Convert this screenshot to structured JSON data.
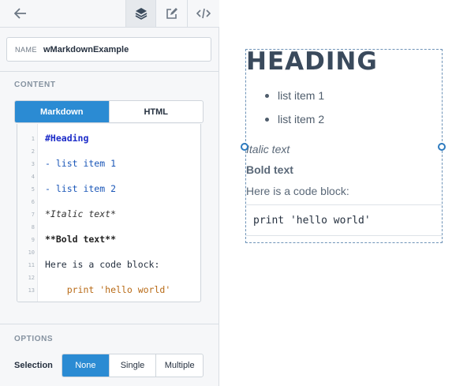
{
  "toolbar": {
    "back_icon": "arrow-left-icon",
    "tabs": [
      "layers-icon",
      "edit-icon",
      "code-icon"
    ]
  },
  "name_field": {
    "label": "NAME",
    "value": "wMarkdownExample"
  },
  "content": {
    "title": "CONTENT",
    "mode_options": [
      "Markdown",
      "HTML"
    ],
    "selected_mode": "Markdown"
  },
  "editor": {
    "line_numbers": [
      "1",
      "2",
      "3",
      "4",
      "5",
      "6",
      "7",
      "8",
      "9",
      "10",
      "11",
      "12",
      "13"
    ],
    "lines": {
      "l1": "#Heading",
      "l3": "- list item 1",
      "l5": "- list item 2",
      "l7": "*Italic text*",
      "l9": "**Bold text**",
      "l11": "Here is a code block:",
      "l13": "    print 'hello world'"
    }
  },
  "options": {
    "title": "OPTIONS",
    "selection_label": "Selection",
    "selection_options": [
      "None",
      "Single",
      "Multiple"
    ],
    "selected": "None"
  },
  "preview": {
    "heading": "HEADING",
    "list": [
      "list item 1",
      "list item 2"
    ],
    "italic": "Italic text",
    "bold": "Bold text",
    "paragraph": "Here is a code block:",
    "code": "print 'hello world'"
  },
  "colors": {
    "accent": "#2b8bd3",
    "panel_bg": "#f6f7f9",
    "selection_outline": "#6f94b8"
  }
}
